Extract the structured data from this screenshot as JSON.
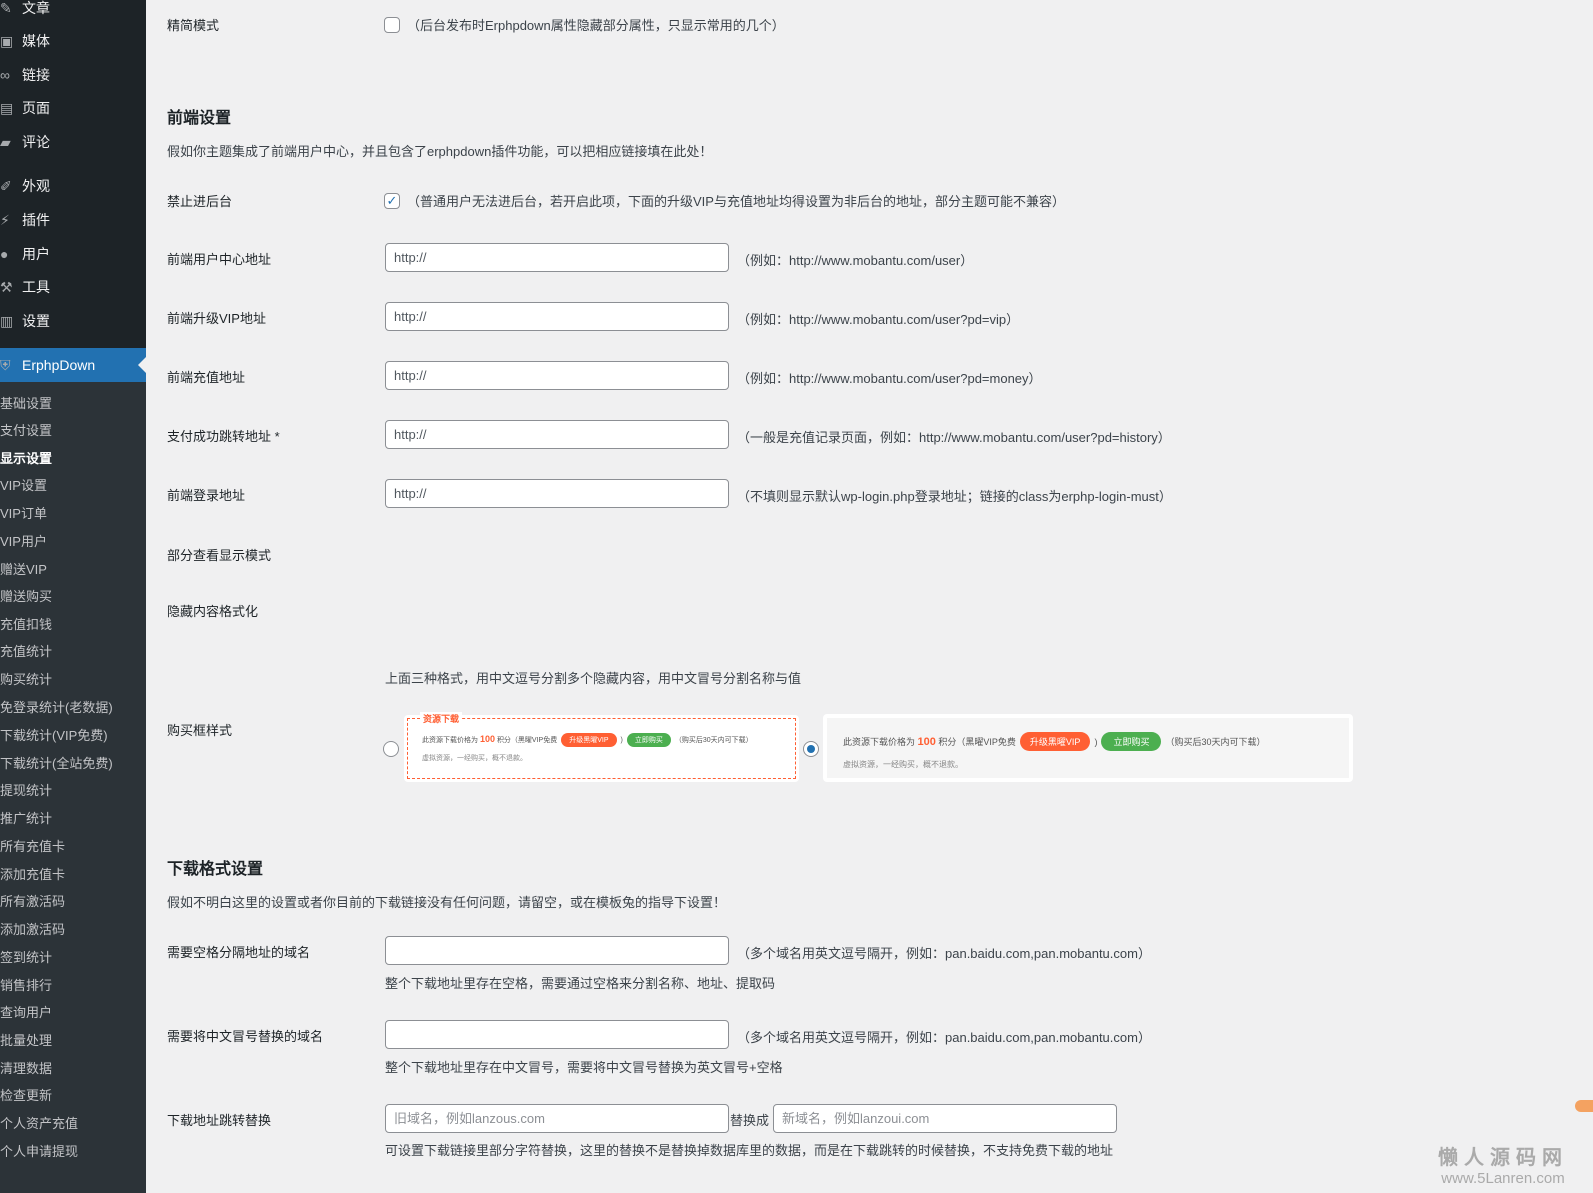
{
  "sidebar": {
    "menu": [
      {
        "label": "文章",
        "icon": "pin-icon"
      },
      {
        "label": "媒体",
        "icon": "media-icon"
      },
      {
        "label": "链接",
        "icon": "link-icon"
      },
      {
        "label": "页面",
        "icon": "page-icon"
      },
      {
        "label": "评论",
        "icon": "comment-icon"
      },
      {
        "label": "外观",
        "icon": "brush-icon"
      },
      {
        "label": "插件",
        "icon": "plugin-icon"
      },
      {
        "label": "用户",
        "icon": "user-icon"
      },
      {
        "label": "工具",
        "icon": "wrench-icon"
      },
      {
        "label": "设置",
        "icon": "settings-icon"
      },
      {
        "label": "ErphpDown",
        "icon": "shield-icon"
      }
    ],
    "submenu": [
      "基础设置",
      "支付设置",
      "显示设置",
      "VIP设置",
      "VIP订单",
      "VIP用户",
      "赠送VIP",
      "赠送购买",
      "充值扣钱",
      "充值统计",
      "购买统计",
      "免登录统计(老数据)",
      "下载统计(VIP免费)",
      "下载统计(全站免费)",
      "提现统计",
      "推广统计",
      "所有充值卡",
      "添加充值卡",
      "所有激活码",
      "添加激活码",
      "签到统计",
      "销售排行",
      "查询用户",
      "批量处理",
      "清理数据",
      "检查更新",
      "个人资产充值",
      "个人申请提现"
    ]
  },
  "main": {
    "simple_mode": {
      "label": "精简模式",
      "desc": "（后台发布时Erphpdown属性隐藏部分属性，只显示常用的几个）",
      "checked": false
    },
    "frontend": {
      "title": "前端设置",
      "intro": "假如你主题集成了前端用户中心，并且包含了erphpdown插件功能，可以把相应链接填在此处！",
      "block_admin": {
        "label": "禁止进后台",
        "desc": "（普通用户无法进后台，若开启此项，下面的升级VIP与充值地址均得设置为非后台的地址，部分主题可能不兼容）",
        "checked": true
      },
      "fields": [
        {
          "label": "前端用户中心地址",
          "value": "http://",
          "hint": "（例如：http://www.mobantu.com/user）"
        },
        {
          "label": "前端升级VIP地址",
          "value": "http://",
          "hint": "（例如：http://www.mobantu.com/user?pd=vip）"
        },
        {
          "label": "前端充值地址",
          "value": "http://",
          "hint": "（例如：http://www.mobantu.com/user?pd=money）"
        },
        {
          "label": "支付成功跳转地址 *",
          "value": "http://",
          "hint": "（一般是充值记录页面，例如：http://www.mobantu.com/user?pd=history）"
        },
        {
          "label": "前端登录地址",
          "value": "http://",
          "hint": "（不填则显示默认wp-login.php登录地址；链接的class为erphp-login-must）"
        }
      ],
      "partial_view": "部分查看显示模式",
      "hidden_format": "隐藏内容格式化",
      "format_note": "上面三种格式，用中文逗号分割多个隐藏内容，用中文冒号分割名称与值",
      "buy_box": {
        "label": "购买框样式",
        "selected": 2,
        "style1": {
          "title": "资源下载",
          "price_text": "此资源下载价格为",
          "price": "100",
          "unit": "积分（黑曜VIP免费",
          "vip_btn": "升级黑曜VIP",
          "buy_btn": "立即购买",
          "after": "（购买后30天内可下载）",
          "note": "虚拟资源，一经购买，概不退款。"
        },
        "style2": {
          "price_text": "此资源下载价格为",
          "price": "100",
          "unit": "积分（黑曜VIP免费",
          "vip_btn": "升级黑曜VIP",
          "buy_btn": "立即购买",
          "after": "（购买后30天内可下载）",
          "note": "虚拟资源，一经购买，概不退款。"
        }
      }
    },
    "download": {
      "title": "下载格式设置",
      "intro": "假如不明白这里的设置或者你目前的下载链接没有任何问题，请留空，或在模板兔的指导下设置！",
      "space_domain": {
        "label": "需要空格分隔地址的域名",
        "value": "",
        "hint": "（多个域名用英文逗号隔开，例如：pan.baidu.com,pan.mobantu.com）",
        "note": "整个下载地址里存在空格，需要通过空格来分割名称、地址、提取码"
      },
      "colon_domain": {
        "label": "需要将中文冒号替换的域名",
        "value": "",
        "hint": "（多个域名用英文逗号隔开，例如：pan.baidu.com,pan.mobantu.com）",
        "note": "整个下载地址里存在中文冒号，需要将中文冒号替换为英文冒号+空格"
      },
      "redirect": {
        "label": "下载地址跳转替换",
        "old_placeholder": "旧域名，例如lanzous.com",
        "replace_with": "替换成",
        "new_placeholder": "新域名，例如lanzoui.com",
        "note": "可设置下载链接里部分字符替换，这里的替换不是替换掉数据库里的数据，而是在下载跳转的时候替换，不支持免费下载的地址"
      }
    }
  },
  "watermark": {
    "cn": "懒人源码网",
    "url": "www.5Lanren.com"
  },
  "colors": {
    "accent": "#2271b1",
    "orange": "#ff5f33",
    "green": "#4caf50"
  }
}
